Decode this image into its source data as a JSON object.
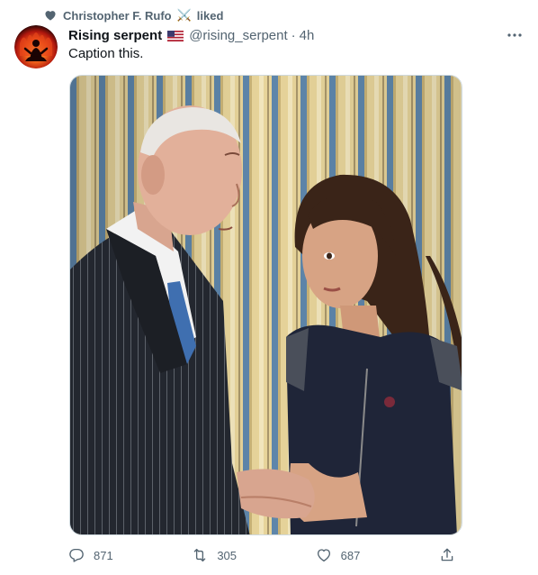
{
  "social_context": {
    "icon": "heart-icon",
    "user": "Christopher F. Rufo",
    "emoji": "⚔️",
    "action": "liked"
  },
  "tweet": {
    "author_name": "Rising serpent",
    "flag": "us-flag",
    "handle": "@rising_serpent",
    "separator": "·",
    "time": "4h",
    "text": "Caption this."
  },
  "actions": {
    "reply_count": "871",
    "retweet_count": "305",
    "like_count": "687"
  },
  "colors": {
    "text_primary": "#0f1419",
    "text_secondary": "#536471",
    "border": "#cfd9de"
  }
}
